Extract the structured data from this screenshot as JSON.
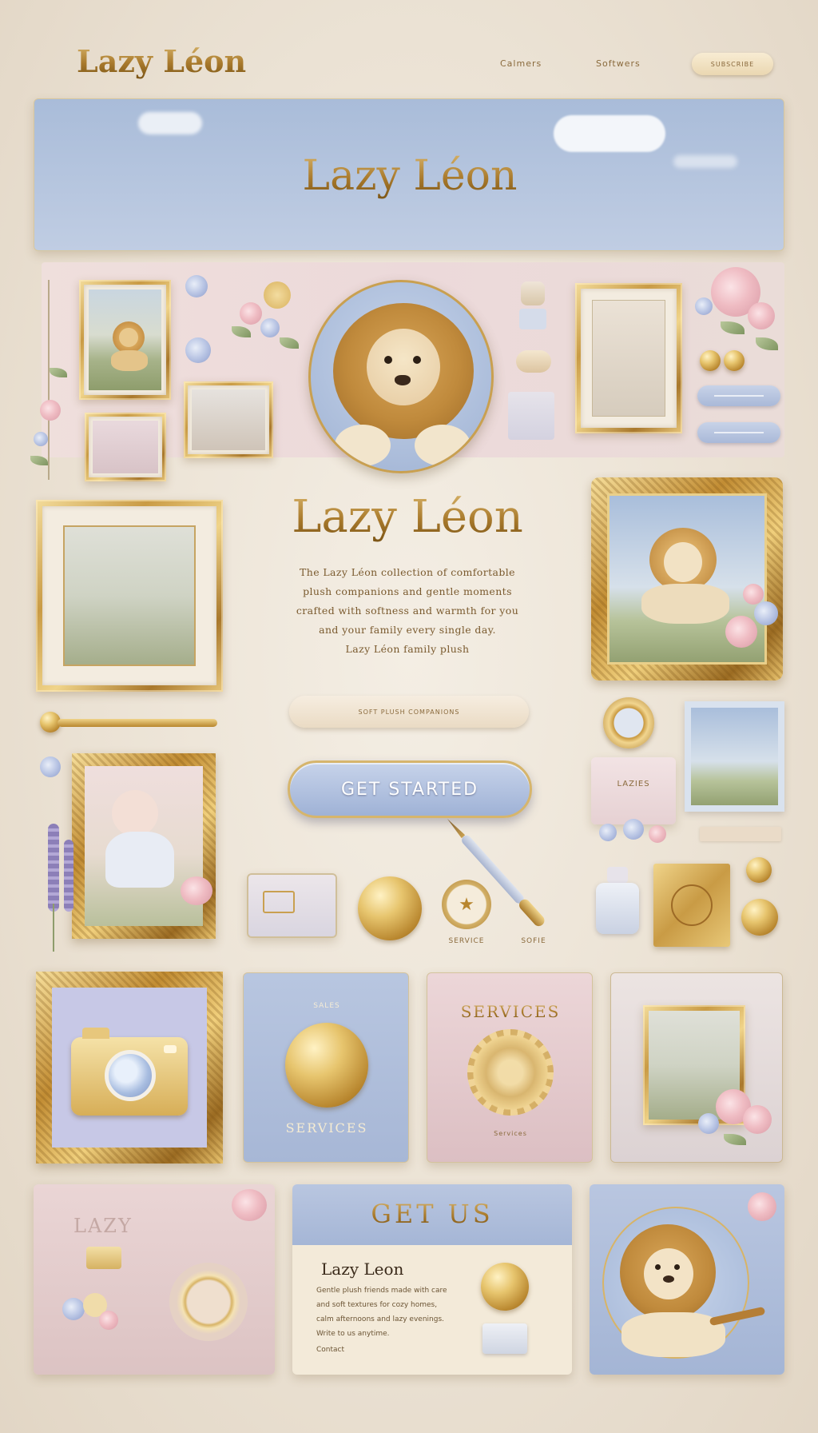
{
  "nav": {
    "brand": "Lazy Léon",
    "links": [
      "",
      "Calmers",
      "Softwers"
    ],
    "cta_label": "SUBSCRIBE"
  },
  "hero": {
    "title": "Lazy Léon"
  },
  "intro": {
    "title": "Lazy Léon",
    "body_lines": [
      "The Lazy Léon collection of comfortable",
      "plush companions and gentle moments",
      "crafted with softness and warmth for you",
      "and your family every single day.",
      "Lazy Léon family plush"
    ],
    "subpill_label": "SOFT PLUSH COMPANIONS"
  },
  "cta": {
    "get_started": "GET STARTED"
  },
  "small_tiles": {
    "left_label": "SERVICE",
    "right_label": "SOFIE"
  },
  "side_card": {
    "label": "LAZIES"
  },
  "cards": {
    "services_blue": {
      "top": "SALES",
      "bottom": "SERVICES"
    },
    "services_pink": {
      "top": "SERVICES",
      "bottom": "Services"
    }
  },
  "bottom": {
    "left_title": "LAZY",
    "get_us_title": "GET US",
    "get_us_brand": "Lazy Leon",
    "get_us_lines": [
      "Gentle plush friends made with care",
      "and soft textures for cozy homes,",
      "calm afternoons and lazy evenings.",
      "Write to us anytime."
    ],
    "get_us_footer": "Contact"
  },
  "colors": {
    "gold": "#b8862e",
    "powder_blue": "#b4c4e0",
    "blush_pink": "#e8cfd2",
    "cream": "#f3ece0"
  }
}
